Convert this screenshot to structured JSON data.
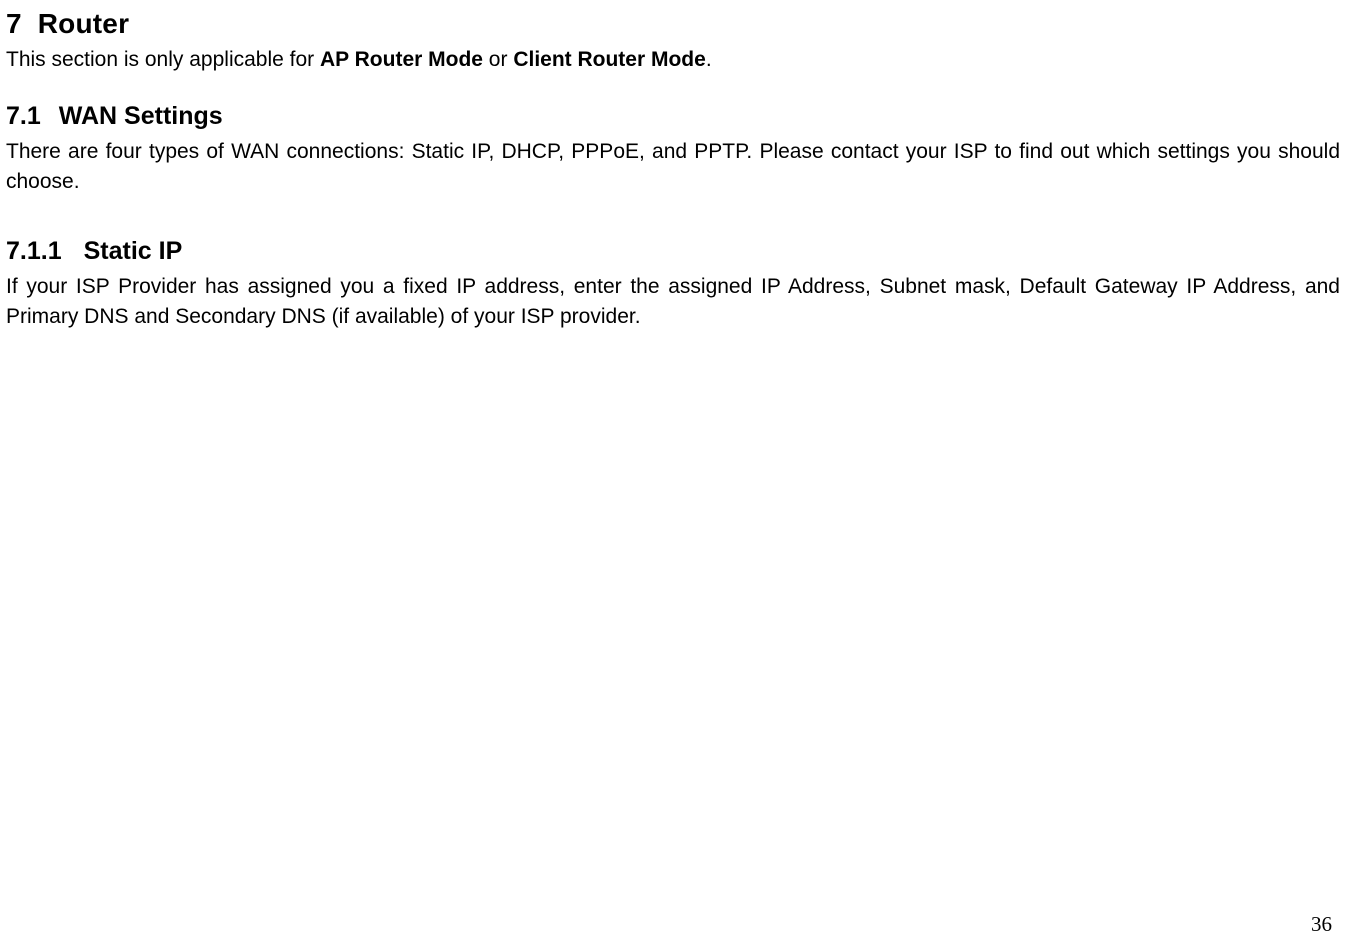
{
  "section": {
    "number": "7",
    "title": "Router",
    "intro_before": "This section is only applicable for ",
    "intro_bold1": "AP Router Mode",
    "intro_mid": " or ",
    "intro_bold2": "Client Router Mode",
    "intro_after": "."
  },
  "subsection": {
    "number": "7.1",
    "title": "WAN Settings",
    "body": "There are four types of WAN connections: Static IP, DHCP, PPPoE, and PPTP. Please contact your ISP to find out which settings you should choose."
  },
  "subsubsection": {
    "number": "7.1.1",
    "title": "Static IP",
    "body": "If your ISP Provider has assigned you a fixed IP address, enter the assigned IP Address, Subnet mask, Default Gateway IP Address, and Primary DNS and Secondary DNS (if available) of your ISP provider."
  },
  "page_number": "36"
}
